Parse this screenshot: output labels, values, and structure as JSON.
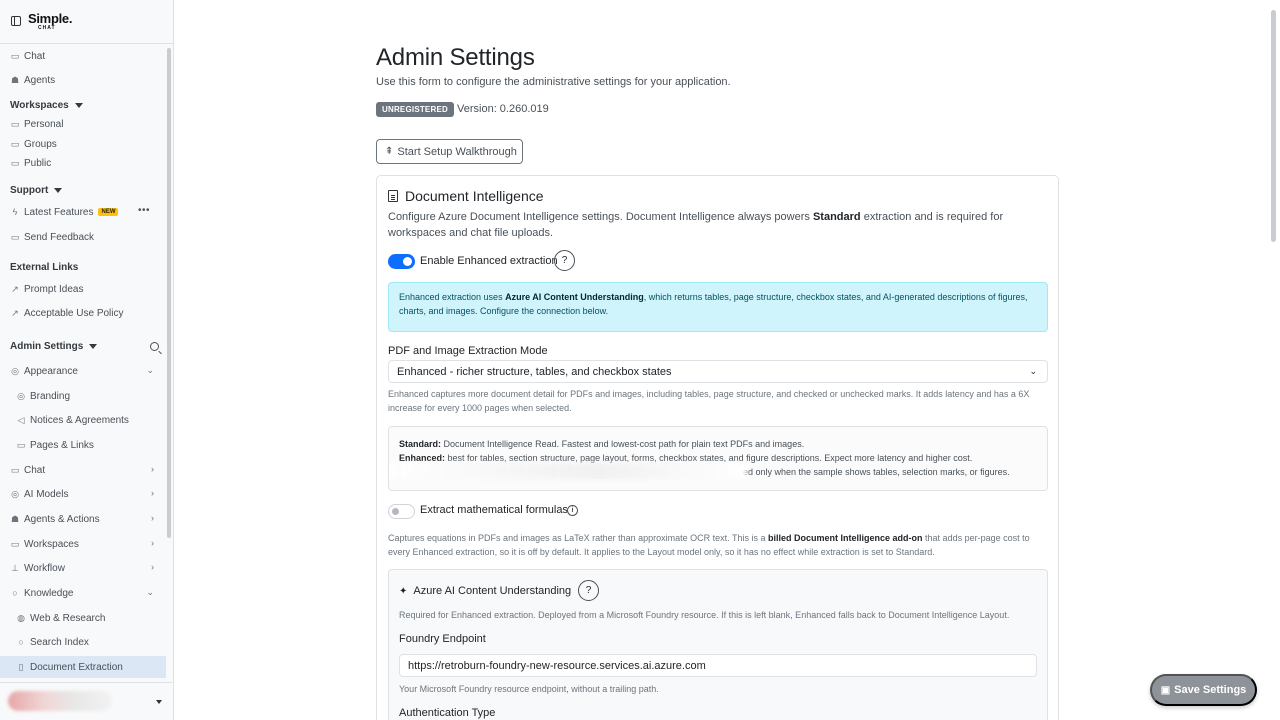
{
  "app": {
    "logo_text": "Simple.",
    "logo_sub": "CHAT"
  },
  "sidebar": {
    "top_items": [
      {
        "label": "Chat",
        "icon": "chat-icon"
      },
      {
        "label": "Agents",
        "icon": "robot-icon"
      }
    ],
    "workspaces_header": "Workspaces",
    "workspaces": [
      {
        "label": "Personal",
        "icon": "folder-icon"
      },
      {
        "label": "Groups",
        "icon": "folder-icon"
      },
      {
        "label": "Public",
        "icon": "folder-icon"
      }
    ],
    "support_header": "Support",
    "support": [
      {
        "label": "Latest Features",
        "badge": "NEW",
        "icon": "lightning-icon"
      },
      {
        "label": "Send Feedback",
        "icon": "feedback-icon"
      }
    ],
    "external_header": "External Links",
    "external": [
      {
        "label": "Prompt Ideas",
        "icon": "external-link-icon"
      },
      {
        "label": "Acceptable Use Policy",
        "icon": "external-link-icon"
      }
    ],
    "admin_header": "Admin Settings",
    "admin": [
      {
        "label": "Appearance",
        "level": 1,
        "chevron": "down"
      },
      {
        "label": "Branding",
        "level": 2
      },
      {
        "label": "Notices & Agreements",
        "level": 2
      },
      {
        "label": "Pages & Links",
        "level": 2
      },
      {
        "label": "Chat",
        "level": 1,
        "chevron": "right"
      },
      {
        "label": "AI Models",
        "level": 1,
        "chevron": "right"
      },
      {
        "label": "Agents & Actions",
        "level": 1,
        "chevron": "right"
      },
      {
        "label": "Workspaces",
        "level": 1,
        "chevron": "right"
      },
      {
        "label": "Workflow",
        "level": 1,
        "chevron": "right"
      },
      {
        "label": "Knowledge",
        "level": 1,
        "chevron": "down"
      },
      {
        "label": "Web & Research",
        "level": 2
      },
      {
        "label": "Search Index",
        "level": 2
      },
      {
        "label": "Document Extraction",
        "level": 2,
        "active": true
      }
    ]
  },
  "page": {
    "title": "Admin Settings",
    "lead": "Use this form to configure the administrative settings for your application.",
    "status_badge": "UNREGISTERED",
    "version": "Version: 0.260.019",
    "walkthrough_button": "Start Setup Walkthrough",
    "save_button": "Save Settings"
  },
  "doc_intel": {
    "title": "Document Intelligence",
    "desc_before": "Configure Azure Document Intelligence settings. Document Intelligence always powers ",
    "desc_bold": "Standard",
    "desc_after": " extraction and is required for workspaces and chat file uploads.",
    "enhanced_toggle_label": "Enable Enhanced extraction",
    "enhanced_enabled": true,
    "help_glyph": "?",
    "alert_before": "Enhanced extraction uses ",
    "alert_bold": "Azure AI Content Understanding",
    "alert_after": ", which returns tables, page structure, checkbox states, and AI-generated descriptions of figures, charts, and images. Configure the connection below.",
    "mode_label": "PDF and Image Extraction Mode",
    "mode_value": "Enhanced - richer structure, tables, and checkbox states",
    "mode_help": "Enhanced captures more document detail for PDFs and images, including tables, page structure, and checked or unchecked marks. It adds latency and has a 6X increase for every 1000 pages when selected.",
    "modes_standard_label": "Standard:",
    "modes_standard_text": " Document Intelligence Read. Fastest and lowest-cost path for plain text PDFs and images.",
    "modes_enhanced_label": "Enhanced:",
    "modes_enhanced_text": " best for tables, section structure, page layout, forms, checkbox states, and figure descriptions. Expect more latency and higher cost.",
    "modes_third_line": "ed only when the sample shows tables, selection marks, or figures.",
    "formula_toggle_label": "Extract mathematical formulas",
    "formula_enabled": false,
    "formula_help_before": "Captures equations in PDFs and images as LaTeX rather than approximate OCR text. This is a ",
    "formula_help_bold": "billed Document Intelligence add-on",
    "formula_help_after": " that adds per-page cost to every Enhanced extraction, so it is off by default. It applies to the Layout model only, so it has no effect while extraction is set to Standard."
  },
  "content_understanding": {
    "title": "Azure AI Content Understanding",
    "desc": "Required for Enhanced extraction. Deployed from a Microsoft Foundry resource. If this is left blank, Enhanced falls back to Document Intelligence Layout.",
    "endpoint_label": "Foundry Endpoint",
    "endpoint_value": "https://retroburn-foundry-new-resource.services.ai.azure.com",
    "endpoint_help": "Your Microsoft Foundry resource endpoint, without a trailing path.",
    "auth_label": "Authentication Type"
  }
}
